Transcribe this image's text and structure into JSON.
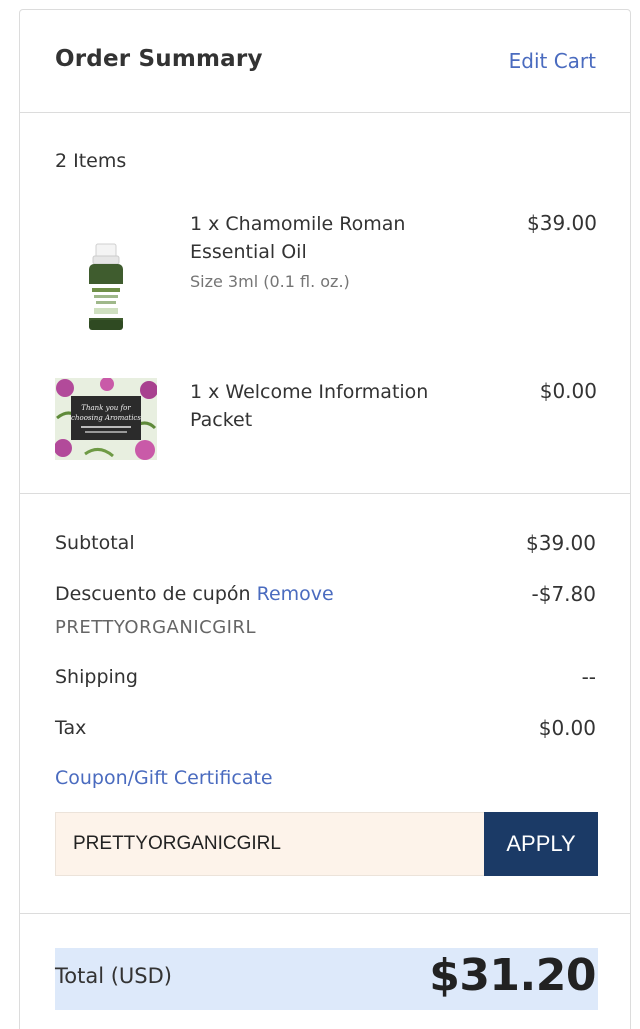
{
  "header": {
    "title": "Order Summary",
    "edit_cart_label": "Edit Cart"
  },
  "items": {
    "count_label": "2 Items",
    "list": [
      {
        "name": "1 x Chamomile Roman Essential Oil",
        "variant": "Size 3ml (0.1 fl. oz.)",
        "price": "$39.00",
        "thumb_icon": "essential-oil-bottle-image"
      },
      {
        "name": "1 x Welcome Information Packet",
        "price": "$0.00",
        "thumb_icon": "welcome-card-image",
        "thumb_text": "Thank you for choosing Aromatics"
      }
    ]
  },
  "totals": {
    "subtotal_label": "Subtotal",
    "subtotal_value": "$39.00",
    "discount_label": "Descuento de cupón",
    "discount_remove_label": "Remove",
    "discount_code": "PRETTYORGANICGIRL",
    "discount_value": "-$7.80",
    "shipping_label": "Shipping",
    "shipping_value": "--",
    "tax_label": "Tax",
    "tax_value": "$0.00"
  },
  "coupon": {
    "link_label": "Coupon/Gift Certificate",
    "input_value": "PRETTYORGANICGIRL",
    "apply_label": "APPLY"
  },
  "grand_total": {
    "label": "Total (USD)",
    "value": "$31.20"
  },
  "colors": {
    "link": "#4a6bbf",
    "apply_button": "#1b3a66",
    "coupon_input_bg": "#fdf3ea",
    "total_row_bg": "#dde9fa"
  }
}
